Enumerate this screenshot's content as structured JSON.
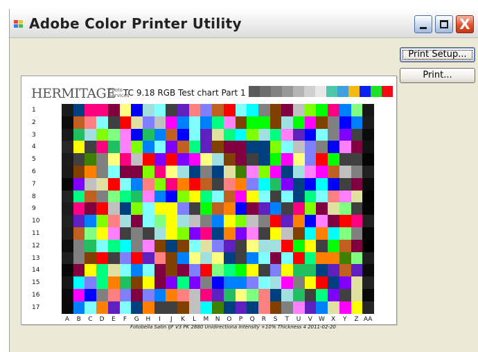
{
  "window": {
    "title": "Adobe Color Printer Utility",
    "icon": "app-icon",
    "controls": {
      "minimize_icon": "minimize-icon",
      "maximize_icon": "maximize-icon",
      "close_icon": "close-icon",
      "close_glyph": "X"
    }
  },
  "buttons": {
    "print_setup": "Print Setup...",
    "print": "Print..."
  },
  "preview": {
    "brand": "HERMITAGE",
    "brand_sub": [
      "Photo",
      "Services"
    ],
    "chart_title": "TC 9.18 RGB Test chart Part 1",
    "row_labels": [
      "1",
      "2",
      "3",
      "4",
      "5",
      "6",
      "7",
      "8",
      "9",
      "10",
      "11",
      "12",
      "13",
      "14",
      "15",
      "16",
      "17"
    ],
    "column_labels": [
      "A",
      "B",
      "C",
      "D",
      "E",
      "F",
      "G",
      "H",
      "I",
      "J",
      "K",
      "L",
      "M",
      "N",
      "O",
      "P",
      "Q",
      "R",
      "S",
      "T",
      "U",
      "V",
      "W",
      "X",
      "Y",
      "Z",
      "AA"
    ],
    "footer": "Fotobella Satin IJF V3 PK 2880 Unidirectiona Intensity +10% Thickness 4 2011-02-20",
    "reference_strip": [
      "#5a5a5a",
      "#6e6e6e",
      "#828282",
      "#989898",
      "#b4b4b4",
      "#cfcfcf",
      "#e8e8e8",
      "#4cc7a9",
      "#3fa0e0",
      "#f5b80e",
      "#0b20f2",
      "#21e02a",
      "#f20a14"
    ]
  }
}
